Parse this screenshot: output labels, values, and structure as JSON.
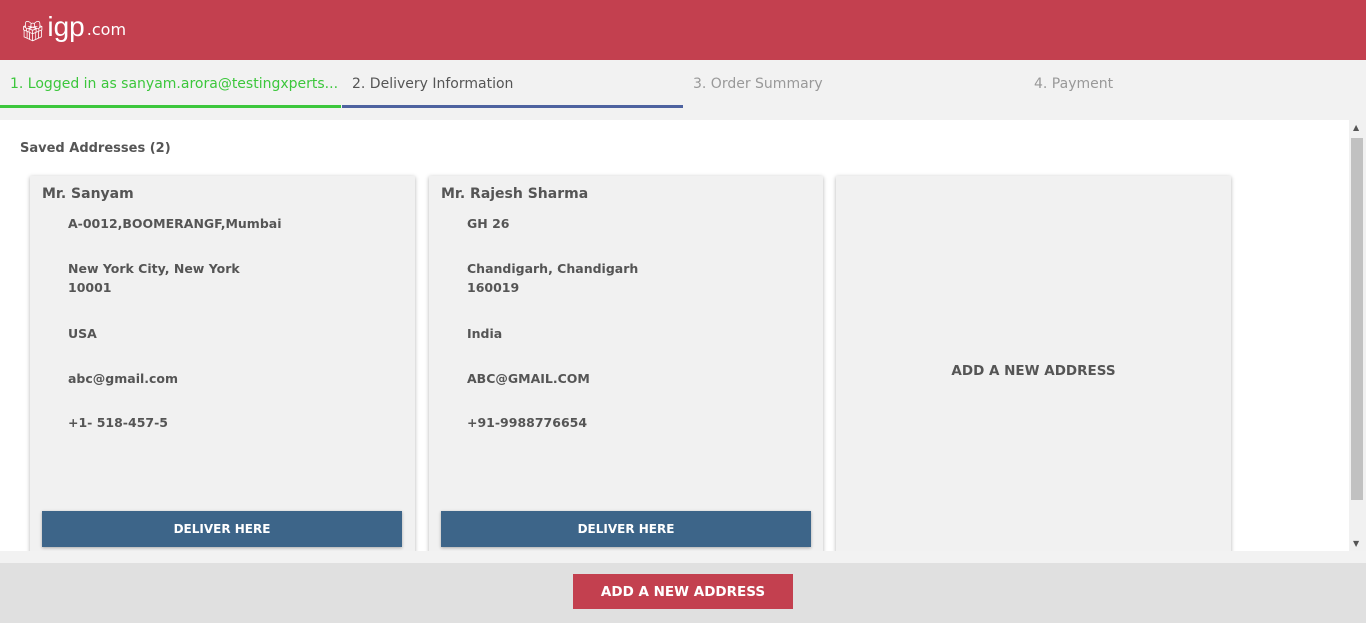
{
  "header": {
    "logo_brand": "igp",
    "logo_domain": ".com"
  },
  "steps": [
    {
      "label": "1. Logged in as sanyam.arora@testingxperts...",
      "state": "done"
    },
    {
      "label": "2. Delivery Information",
      "state": "active"
    },
    {
      "label": "3. Order Summary",
      "state": "pending"
    },
    {
      "label": "4. Payment",
      "state": "pending"
    }
  ],
  "saved_title": "Saved Addresses (2)",
  "addresses": [
    {
      "name": "Mr. Sanyam",
      "line1": "A-0012,BOOMERANGF,Mumbai",
      "city": "New York City, New York",
      "zip": "10001",
      "country": "USA",
      "email": "abc@gmail.com",
      "phone": "+1- 518-457-5",
      "button": "DELIVER HERE"
    },
    {
      "name": "Mr. Rajesh Sharma",
      "line1": "GH 26",
      "city": "Chandigarh, Chandigarh",
      "zip": "160019",
      "country": "India",
      "email": "ABC@GMAIL.COM",
      "phone": "+91-9988776654",
      "button": "DELIVER HERE"
    }
  ],
  "add_card_label": "ADD A NEW ADDRESS",
  "footer_button": "ADD A NEW ADDRESS",
  "colors": {
    "brand": "#c3404f",
    "done": "#3cc73c",
    "active": "#4e63a0",
    "button": "#3d6589"
  }
}
